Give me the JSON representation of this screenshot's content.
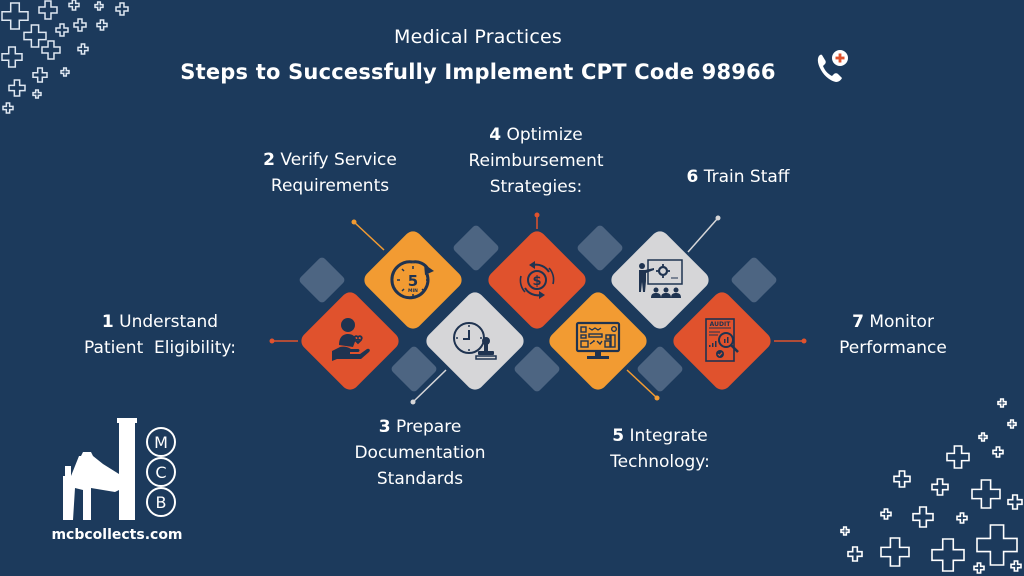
{
  "header": {
    "subtitle": "Medical Practices",
    "title": "Steps to Successfully Implement CPT Code 98966",
    "title_icon": "phone-medical-icon"
  },
  "colors": {
    "background": "#1c3a5c",
    "orange": "#f29b32",
    "red": "#e0522d",
    "light": "#d6d6d8",
    "tile": "#4d6582",
    "icon_dark": "#1f3350"
  },
  "steps": [
    {
      "number": "1",
      "line1": "Understand",
      "line2": "Patient  Eligibility:",
      "line3": "",
      "icon": "patient-care-hand-icon",
      "color": "red"
    },
    {
      "number": "2",
      "line1": "Verify Service",
      "line2": "Requirements",
      "line3": "",
      "icon": "five-minute-timer-icon",
      "color": "orange"
    },
    {
      "number": "3",
      "line1": "Prepare",
      "line2": "Documentation",
      "line3": "Standards",
      "icon": "clock-stamp-icon",
      "color": "light"
    },
    {
      "number": "4",
      "line1": "Optimize",
      "line2": "Reimbursement",
      "line3": "Strategies:",
      "icon": "dollar-cycle-icon",
      "color": "red"
    },
    {
      "number": "5",
      "line1": "Integrate",
      "line2": "Technology:",
      "line3": "",
      "icon": "computer-dashboard-icon",
      "color": "orange"
    },
    {
      "number": "6",
      "line1": "Train Staff",
      "line2": "",
      "line3": "",
      "icon": "training-presentation-icon",
      "color": "light"
    },
    {
      "number": "7",
      "line1": "Monitor",
      "line2": "Performance",
      "line3": "",
      "icon": "audit-report-icon",
      "color": "red"
    }
  ],
  "icon_texts": {
    "timer_number": "5",
    "timer_unit": "MIN",
    "dollar": "$",
    "audit": "AUDIT"
  },
  "logo": {
    "letters": [
      "M",
      "C",
      "B"
    ],
    "url": "mcbcollects.com"
  }
}
